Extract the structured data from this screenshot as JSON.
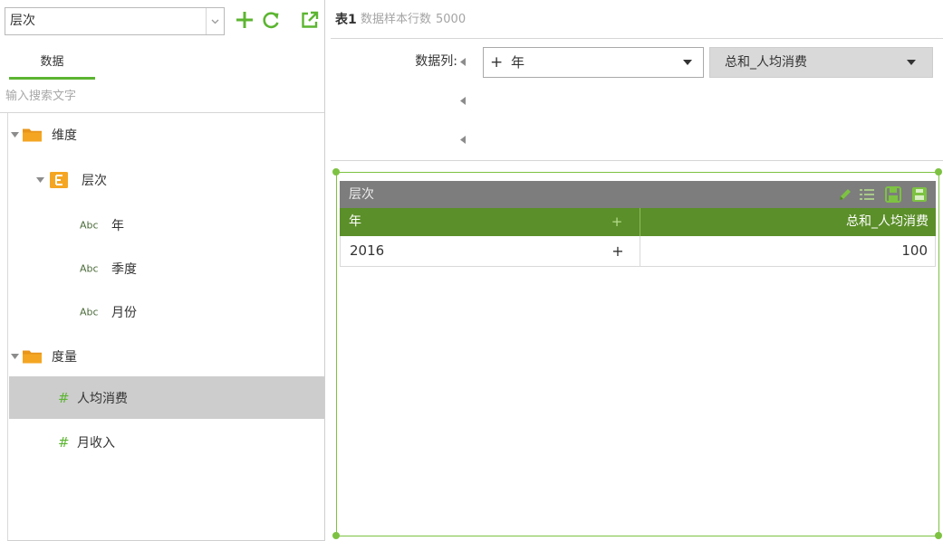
{
  "colors": {
    "accent_green": "#5cb531",
    "table_header_green": "#5b8f29",
    "widget_border_green": "#7dc242",
    "title_bar_gray": "#7d7d7d",
    "folder_orange": "#f4a623",
    "selected_row_gray": "#cdcdcd"
  },
  "left_panel": {
    "hierarchy_select": {
      "value": "层次",
      "icon": "chevron-down-icon"
    },
    "toolbar": {
      "add_icon": "plus-icon",
      "refresh_icon": "refresh-icon",
      "open_icon": "external-link-icon"
    },
    "tabs": [
      {
        "label": "数据",
        "active": true
      }
    ],
    "search": {
      "placeholder": "输入搜索文字"
    },
    "tree": {
      "dimensions": {
        "label": "维度",
        "expanded": true,
        "icon": "folder-icon",
        "hierarchy": {
          "label": "层次",
          "expanded": true,
          "icon": "hierarchy-icon",
          "fields": [
            {
              "type_tag": "Abc",
              "label": "年"
            },
            {
              "type_tag": "Abc",
              "label": "季度"
            },
            {
              "type_tag": "Abc",
              "label": "月份"
            }
          ]
        }
      },
      "measures": {
        "label": "度量",
        "expanded": true,
        "icon": "folder-icon",
        "fields": [
          {
            "type_tag": "#",
            "label": "人均消费",
            "selected": true
          },
          {
            "type_tag": "#",
            "label": "月收入",
            "selected": false
          }
        ]
      }
    }
  },
  "right_panel": {
    "header": {
      "table_name": "表1",
      "sample_label": "数据样本行数",
      "sample_count": "5000"
    },
    "column_binding": {
      "label": "数据列:",
      "slot_icon": "caret-left-icon",
      "dimension_field": {
        "prefix": "+",
        "value": "年",
        "icon": "caret-down-icon"
      },
      "measure_field": {
        "value": "总和_人均消费",
        "icon": "caret-down-icon"
      }
    },
    "table_widget": {
      "title": "层次",
      "toolbar_icons": [
        "pencil-icon",
        "list-icon",
        "save-icon",
        "export-icon"
      ],
      "columns": [
        {
          "label": "年",
          "expand": "+"
        },
        {
          "label": "总和_人均消费"
        }
      ],
      "rows": [
        {
          "cells": [
            "2016",
            "100"
          ],
          "expand": "+"
        }
      ]
    }
  }
}
